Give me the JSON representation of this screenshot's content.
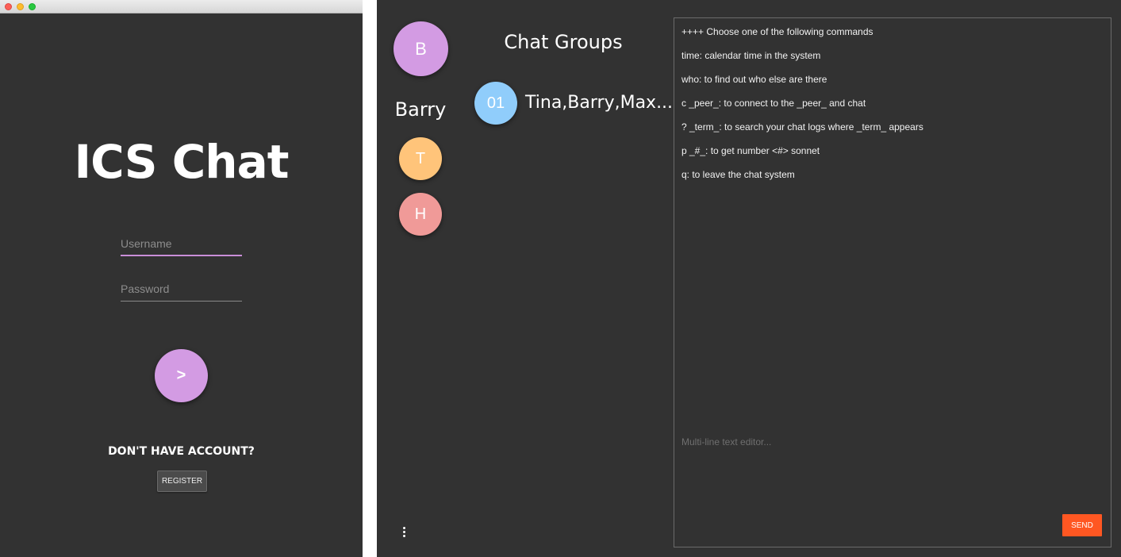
{
  "login": {
    "app_title": "ICS Chat",
    "username_placeholder": "Username",
    "password_placeholder": "Password",
    "submit_label": ">",
    "no_account_text": "DON'T HAVE ACCOUNT?",
    "register_label": "REGISTER"
  },
  "chat": {
    "self": {
      "initial": "B",
      "name": "Barry",
      "color": "#d39be3"
    },
    "peers": [
      {
        "initial": "T",
        "color": "#ffc47a"
      },
      {
        "initial": "H",
        "color": "#f09a98"
      }
    ],
    "groups_header": "Chat Groups",
    "groups": [
      {
        "number": "01",
        "members": "Tina,Barry,Max...",
        "color": "#90cdfb"
      }
    ],
    "log_lines": [
      "++++ Choose one of the following commands",
      "time: calendar time in the system",
      "who: to find out who else are there",
      "c _peer_: to connect to the _peer_ and chat",
      "? _term_: to search your chat logs where _term_ appears",
      "p _#_: to get number <#> sonnet",
      "q: to leave the chat system"
    ],
    "editor_placeholder": "Multi-line text editor...",
    "send_label": "SEND",
    "more_icon": "more-vertical-icon"
  },
  "colors": {
    "background": "#323232",
    "accent_purple": "#d39be3",
    "send_orange": "#ff5722"
  }
}
